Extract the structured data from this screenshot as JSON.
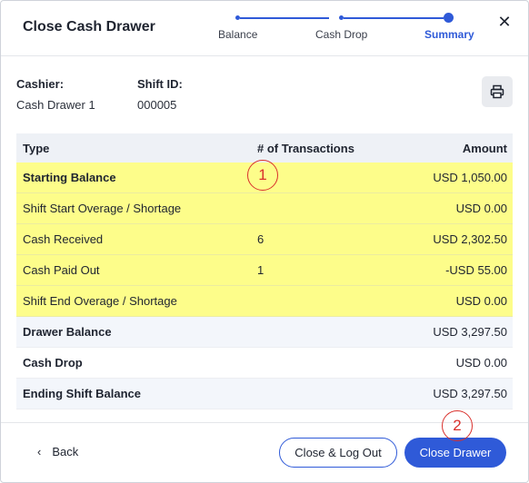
{
  "dialog": {
    "title": "Close Cash Drawer",
    "close_icon": "close-icon"
  },
  "steps": [
    {
      "label": "Balance",
      "state": "done"
    },
    {
      "label": "Cash Drop",
      "state": "done"
    },
    {
      "label": "Summary",
      "state": "active"
    }
  ],
  "info": {
    "cashier_label": "Cashier:",
    "cashier_value": "Cash Drawer 1",
    "shift_label": "Shift ID:",
    "shift_value": "000005",
    "print_icon": "printer-icon"
  },
  "table": {
    "headers": {
      "type": "Type",
      "transactions": "# of Transactions",
      "amount": "Amount"
    },
    "rows": [
      {
        "type": "Starting Balance",
        "transactions": "",
        "amount": "USD 1,050.00"
      },
      {
        "type": "Shift Start Overage / Shortage",
        "transactions": "",
        "amount": "USD 0.00"
      },
      {
        "type": "Cash Received",
        "transactions": "6",
        "amount": "USD 2,302.50"
      },
      {
        "type": "Cash Paid Out",
        "transactions": "1",
        "amount": "-USD 55.00"
      },
      {
        "type": "Shift End Overage / Shortage",
        "transactions": "",
        "amount": "USD 0.00"
      },
      {
        "type": "Drawer Balance",
        "transactions": "",
        "amount": "USD 3,297.50"
      },
      {
        "type": "Cash Drop",
        "transactions": "",
        "amount": "USD 0.00"
      },
      {
        "type": "Ending Shift Balance",
        "transactions": "",
        "amount": "USD 3,297.50"
      }
    ]
  },
  "callouts": [
    "1",
    "2"
  ],
  "footer": {
    "back_label": "Back",
    "close_logout_label": "Close & Log Out",
    "close_drawer_label": "Close Drawer"
  },
  "colors": {
    "accent": "#2f5ad8",
    "highlight": "#fdfd8a",
    "callout": "#d9302c"
  }
}
